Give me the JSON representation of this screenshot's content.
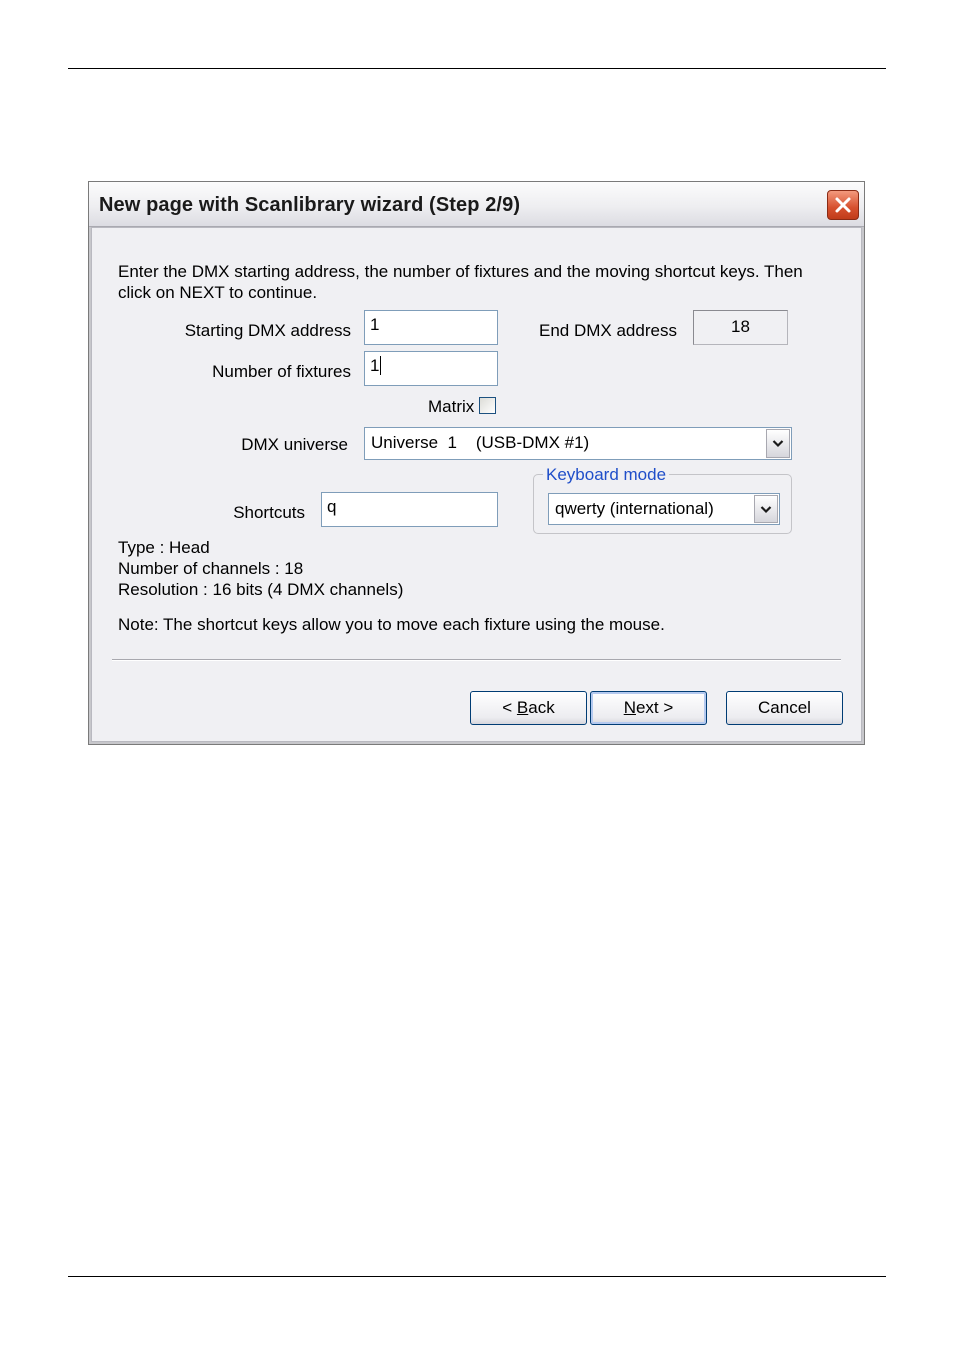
{
  "dialog": {
    "title": "New page with Scanlibrary wizard (Step 2/9)",
    "instructions_line1": "Enter the DMX starting address, the number of fixtures and the moving shortcut keys. Then",
    "instructions_line2": "click on NEXT to continue.",
    "starting_address_label": "Starting DMX address",
    "starting_address_value": "1",
    "end_address_label": "End DMX address",
    "end_address_value": "18",
    "fixtures_label": "Number of fixtures",
    "fixtures_value": "1",
    "matrix_label": "Matrix",
    "universe_label": "DMX universe",
    "universe_value": "Universe  1    (USB-DMX #1)",
    "keyboard_mode_legend": "Keyboard mode",
    "keyboard_mode_value": "qwerty (international)",
    "shortcuts_label": "Shortcuts",
    "shortcuts_value": "q",
    "info_type": "Type : Head",
    "info_channels": "Number of channels : 18",
    "info_resolution": "Resolution : 16 bits (4 DMX channels)",
    "note": "Note: The shortcut keys allow you to move each fixture using the mouse.",
    "buttons": {
      "back_prefix": "< ",
      "back_mnemonic": "B",
      "back_rest": "ack",
      "next_mnemonic": "N",
      "next_rest": "ext >",
      "cancel": "Cancel"
    }
  },
  "icons": {
    "close": "close-x-icon",
    "dropdown": "chevron-down-icon"
  },
  "colors": {
    "close_button": "#d6502e",
    "group_legend": "#1f4ec9",
    "field_border": "#7f9db9"
  }
}
